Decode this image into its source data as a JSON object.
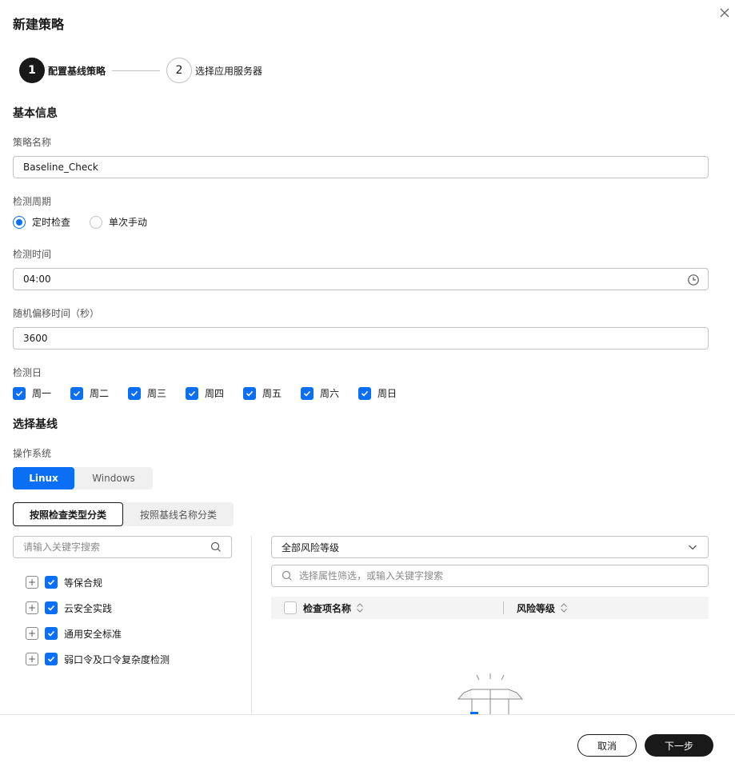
{
  "dialog": {
    "title": "新建策略"
  },
  "steps": [
    {
      "number": "1",
      "label": "配置基线策略"
    },
    {
      "number": "2",
      "label": "选择应用服务器"
    }
  ],
  "basic_info": {
    "section_title": "基本信息",
    "policy_name": {
      "label": "策略名称",
      "value": "Baseline_Check"
    },
    "cycle": {
      "label": "检测周期",
      "options": [
        "定时检查",
        "单次手动"
      ],
      "selected": "定时检查"
    },
    "time": {
      "label": "检测时间",
      "value": "04:00"
    },
    "offset": {
      "label": "随机偏移时间（秒）",
      "value": "3600"
    },
    "days": {
      "label": "检测日",
      "items": [
        "周一",
        "周二",
        "周三",
        "周四",
        "周五",
        "周六",
        "周日"
      ]
    }
  },
  "baseline": {
    "section_title": "选择基线",
    "os_label": "操作系统",
    "os_options": [
      "Linux",
      "Windows"
    ],
    "os_selected": "Linux",
    "category_tabs": [
      "按照检查类型分类",
      "按照基线名称分类"
    ],
    "category_selected": "按照检查类型分类",
    "left_search_placeholder": "请输入关键字搜索",
    "tree": [
      "等保合规",
      "云安全实践",
      "通用安全标准",
      "弱口令及口令复杂度检测"
    ],
    "risk_select": "全部风险等级",
    "right_search_placeholder": "选择属性筛选，或输入关键字搜索",
    "table_headers": [
      "检查项名称",
      "风险等级"
    ]
  },
  "footer": {
    "cancel": "取消",
    "next": "下一步"
  },
  "colors": {
    "accent": "#0b6ff5",
    "dark": "#191919"
  }
}
